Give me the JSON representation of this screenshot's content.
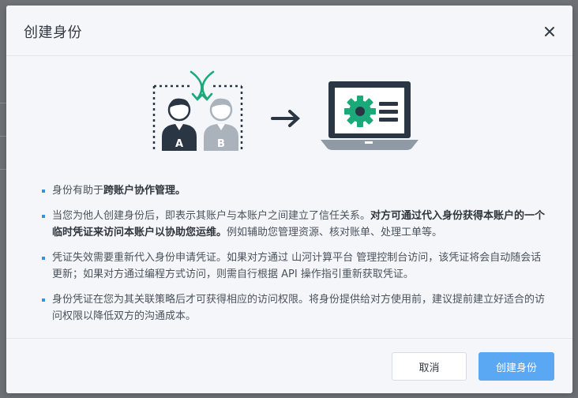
{
  "modal": {
    "title": "创建身份",
    "close_icon": "close-icon"
  },
  "illustration": {
    "user_a_label": "A",
    "user_b_label": "B",
    "icons": [
      "two-users-icon",
      "swap-arrows-icon",
      "arrow-right-icon",
      "laptop-settings-icon"
    ],
    "colors": {
      "accent": "#1aaa7a",
      "dark": "#2b3644",
      "light": "#aab3bc"
    }
  },
  "info": {
    "item1": {
      "prefix": "身份有助于",
      "bold": "跨账户协作管理。"
    },
    "item2": {
      "prefix": "当您为他人创建身份后，即表示其账户与本账户之间建立了信任关系。",
      "bold": "对方可通过代入身份获得本账户的一个临时凭证来访问本账户以协助您运维。",
      "suffix": "例如辅助您管理资源、核对账单、处理工单等。"
    },
    "item3": {
      "text": "凭证失效需要重新代入身份申请凭证。如果对方通过 山河计算平台 管理控制台访问，该凭证将会自动随会话更新；如果对方通过编程方式访问，则需自行根据 API 操作指引重新获取凭证。"
    },
    "item4": {
      "text": "身份凭证在您为其关联策略后才可获得相应的访问权限。将身份提供给对方使用前，建议提前建立好适合的访问权限以降低双方的沟通成本。"
    }
  },
  "footer": {
    "cancel_label": "取消",
    "create_label": "创建身份"
  },
  "colors": {
    "primary": "#5aa7f3",
    "bullet": "#3a8ee6"
  }
}
